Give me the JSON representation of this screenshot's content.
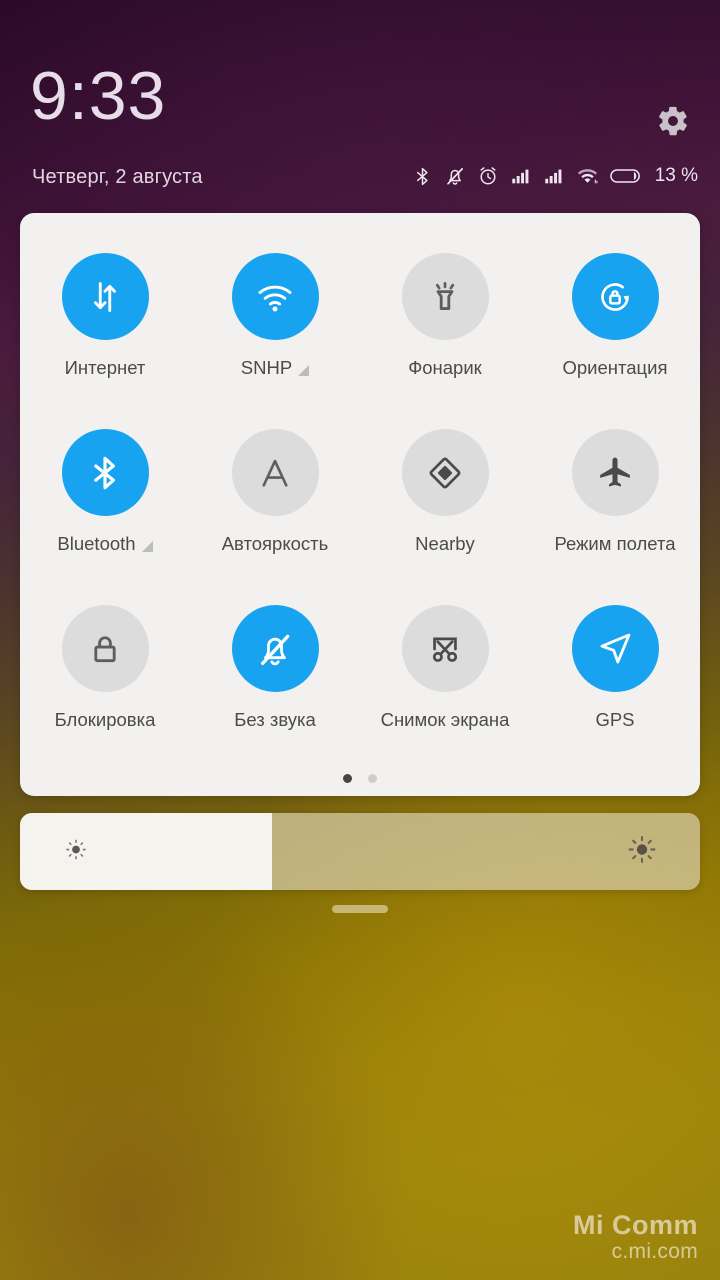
{
  "status_bar": {
    "clock": "9:33",
    "date": "Четверг, 2 августа",
    "battery_percent": "13 %",
    "icons": [
      "bluetooth-icon",
      "mute-bell-icon",
      "alarm-clock-icon",
      "signal-sim1-icon",
      "signal-sim2-icon",
      "wifi-icon",
      "battery-icon"
    ],
    "settings_icon": "gear-icon"
  },
  "quick_settings": {
    "tiles": [
      {
        "label": "Интернет",
        "icon": "data-transfer-icon",
        "state": "on",
        "indicator": false
      },
      {
        "label": "SNHP",
        "icon": "wifi-icon",
        "state": "on",
        "indicator": true
      },
      {
        "label": "Фонарик",
        "icon": "flashlight-icon",
        "state": "off",
        "indicator": false
      },
      {
        "label": "Ориентация",
        "icon": "rotation-lock-icon",
        "state": "on",
        "indicator": false
      },
      {
        "label": "Bluetooth",
        "icon": "bluetooth-icon",
        "state": "on",
        "indicator": true
      },
      {
        "label": "Автояркость",
        "icon": "auto-brightness-icon",
        "state": "off",
        "indicator": false
      },
      {
        "label": "Nearby",
        "icon": "nearby-icon",
        "state": "off",
        "indicator": false
      },
      {
        "label": "Режим полета",
        "icon": "airplane-icon",
        "state": "off",
        "indicator": false
      },
      {
        "label": "Блокировка",
        "icon": "lock-icon",
        "state": "off",
        "indicator": false
      },
      {
        "label": "Без звука",
        "icon": "mute-bell-icon",
        "state": "on",
        "indicator": false
      },
      {
        "label": "Снимок экрана",
        "icon": "screenshot-icon",
        "state": "off",
        "indicator": false
      },
      {
        "label": "GPS",
        "icon": "navigation-icon",
        "state": "on",
        "indicator": false
      }
    ],
    "pages": {
      "count": 2,
      "active_index": 0
    }
  },
  "brightness_slider": {
    "value_percent": 37,
    "left_icon": "brightness-low-icon",
    "right_icon": "brightness-high-icon"
  },
  "watermark": {
    "main": "Mi Comm",
    "sub": "c.mi.com"
  },
  "colors": {
    "accent_on": "#18a3f0",
    "tile_off": "#dcdcdc",
    "panel_bg": "#f2f1ef",
    "label": "#4b4b4b"
  }
}
